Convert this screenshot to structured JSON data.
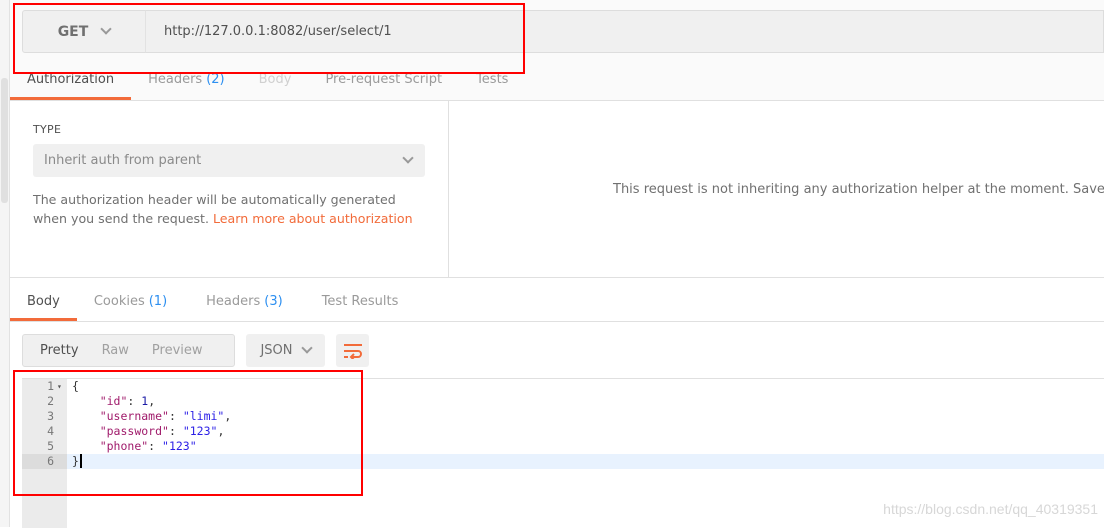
{
  "request": {
    "method": "GET",
    "url": "http://127.0.0.1:8082/user/select/1"
  },
  "request_tabs": [
    {
      "label": "Authorization",
      "count": ""
    },
    {
      "label": "Headers",
      "count": "(2)"
    },
    {
      "label": "Body",
      "count": ""
    },
    {
      "label": "Pre-request Script",
      "count": ""
    },
    {
      "label": "Tests",
      "count": ""
    }
  ],
  "auth": {
    "type_label": "TYPE",
    "type_value": "Inherit auth from parent",
    "desc": "The authorization header will be automatically generated when you send the request. ",
    "learn_more": "Learn more about authorization",
    "right_message": "This request is not inheriting any authorization helper at the moment. Save it in"
  },
  "response_tabs": [
    {
      "label": "Body",
      "count": ""
    },
    {
      "label": "Cookies",
      "count": "(1)"
    },
    {
      "label": "Headers",
      "count": "(3)"
    },
    {
      "label": "Test Results",
      "count": ""
    }
  ],
  "view_modes": [
    "Pretty",
    "Raw",
    "Preview"
  ],
  "format": "JSON",
  "icons": {
    "wrap": "wrap-lines-icon",
    "method_dropdown": "chevron-down-icon"
  },
  "colors": {
    "accent": "#f26b3a",
    "count": "#2d8ff0",
    "annotation": "#ff0000"
  },
  "code_lines": [
    {
      "n": "1",
      "parts": [
        [
          "p",
          "{"
        ]
      ]
    },
    {
      "n": "2",
      "parts": [
        [
          "p",
          "    "
        ],
        [
          "k",
          "\"id\""
        ],
        [
          "p",
          ": "
        ],
        [
          "n",
          "1"
        ],
        [
          "p",
          ","
        ]
      ]
    },
    {
      "n": "3",
      "parts": [
        [
          "p",
          "    "
        ],
        [
          "k",
          "\"username\""
        ],
        [
          "p",
          ": "
        ],
        [
          "s",
          "\"limi\""
        ],
        [
          "p",
          ","
        ]
      ]
    },
    {
      "n": "4",
      "parts": [
        [
          "p",
          "    "
        ],
        [
          "k",
          "\"password\""
        ],
        [
          "p",
          ": "
        ],
        [
          "s",
          "\"123\""
        ],
        [
          "p",
          ","
        ]
      ]
    },
    {
      "n": "5",
      "parts": [
        [
          "p",
          "    "
        ],
        [
          "k",
          "\"phone\""
        ],
        [
          "p",
          ": "
        ],
        [
          "s",
          "\"123\""
        ]
      ]
    },
    {
      "n": "6",
      "parts": [
        [
          "p",
          "}"
        ]
      ]
    }
  ],
  "watermark": "https://blog.csdn.net/qq_40319351"
}
